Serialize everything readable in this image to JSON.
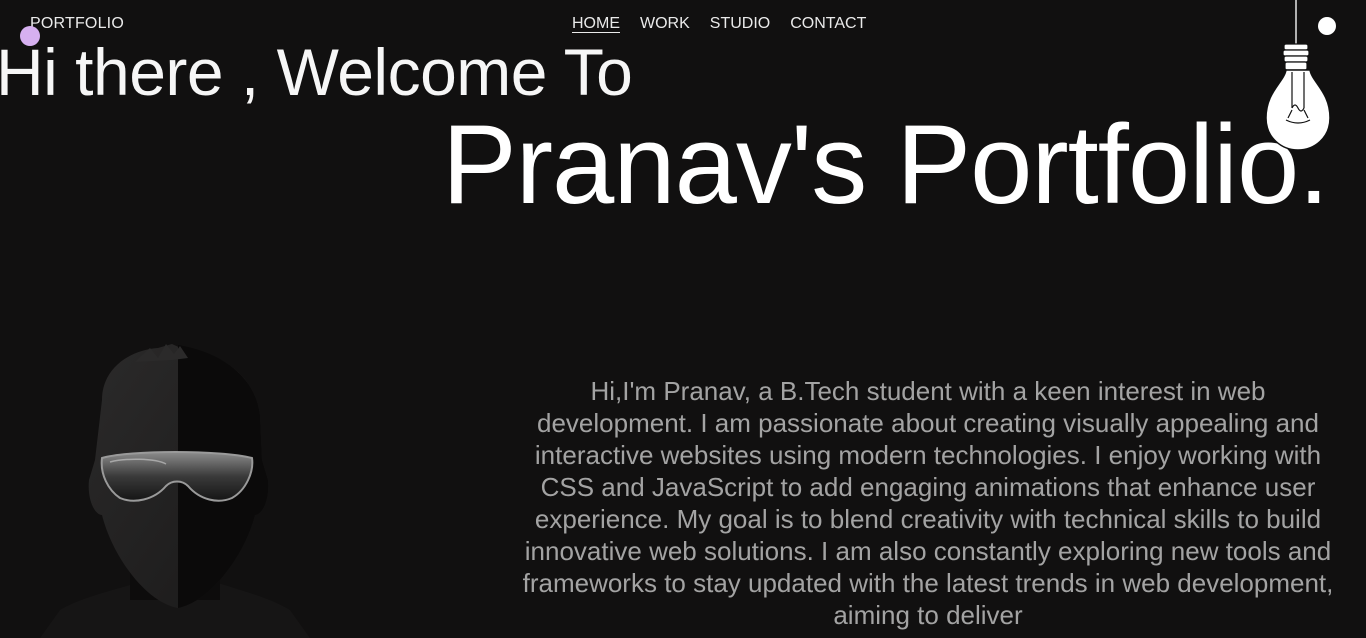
{
  "header": {
    "brand": "PORTFOLIO",
    "nav": [
      {
        "label": "HOME",
        "active": true
      },
      {
        "label": "WORK",
        "active": false
      },
      {
        "label": "STUDIO",
        "active": false
      },
      {
        "label": "CONTACT",
        "active": false
      }
    ]
  },
  "hero": {
    "greeting": "Hi there , Welcome To",
    "title": "Pranav's Portfolio."
  },
  "about": {
    "bio": "Hi,I'm Pranav, a B.Tech student with a keen interest in web development. I am passionate about creating visually appealing and interactive websites using modern technologies. I enjoy working with CSS and JavaScript to add engaging animations that enhance user experience. My goal is to blend creativity with technical skills to build innovative web solutions. I am also constantly exploring new tools and frameworks to stay updated with the latest trends in web development, aiming to deliver"
  },
  "icons": {
    "cursor": "cursor-dot-icon",
    "theme_toggle": "theme-toggle-icon",
    "bulb": "light-bulb-icon",
    "avatar": "avatar-silhouette"
  },
  "colors": {
    "background": "#111010",
    "text": "#f2f2f2",
    "bio_text": "#a3a3a3",
    "cursor": "#d6b0f0"
  }
}
